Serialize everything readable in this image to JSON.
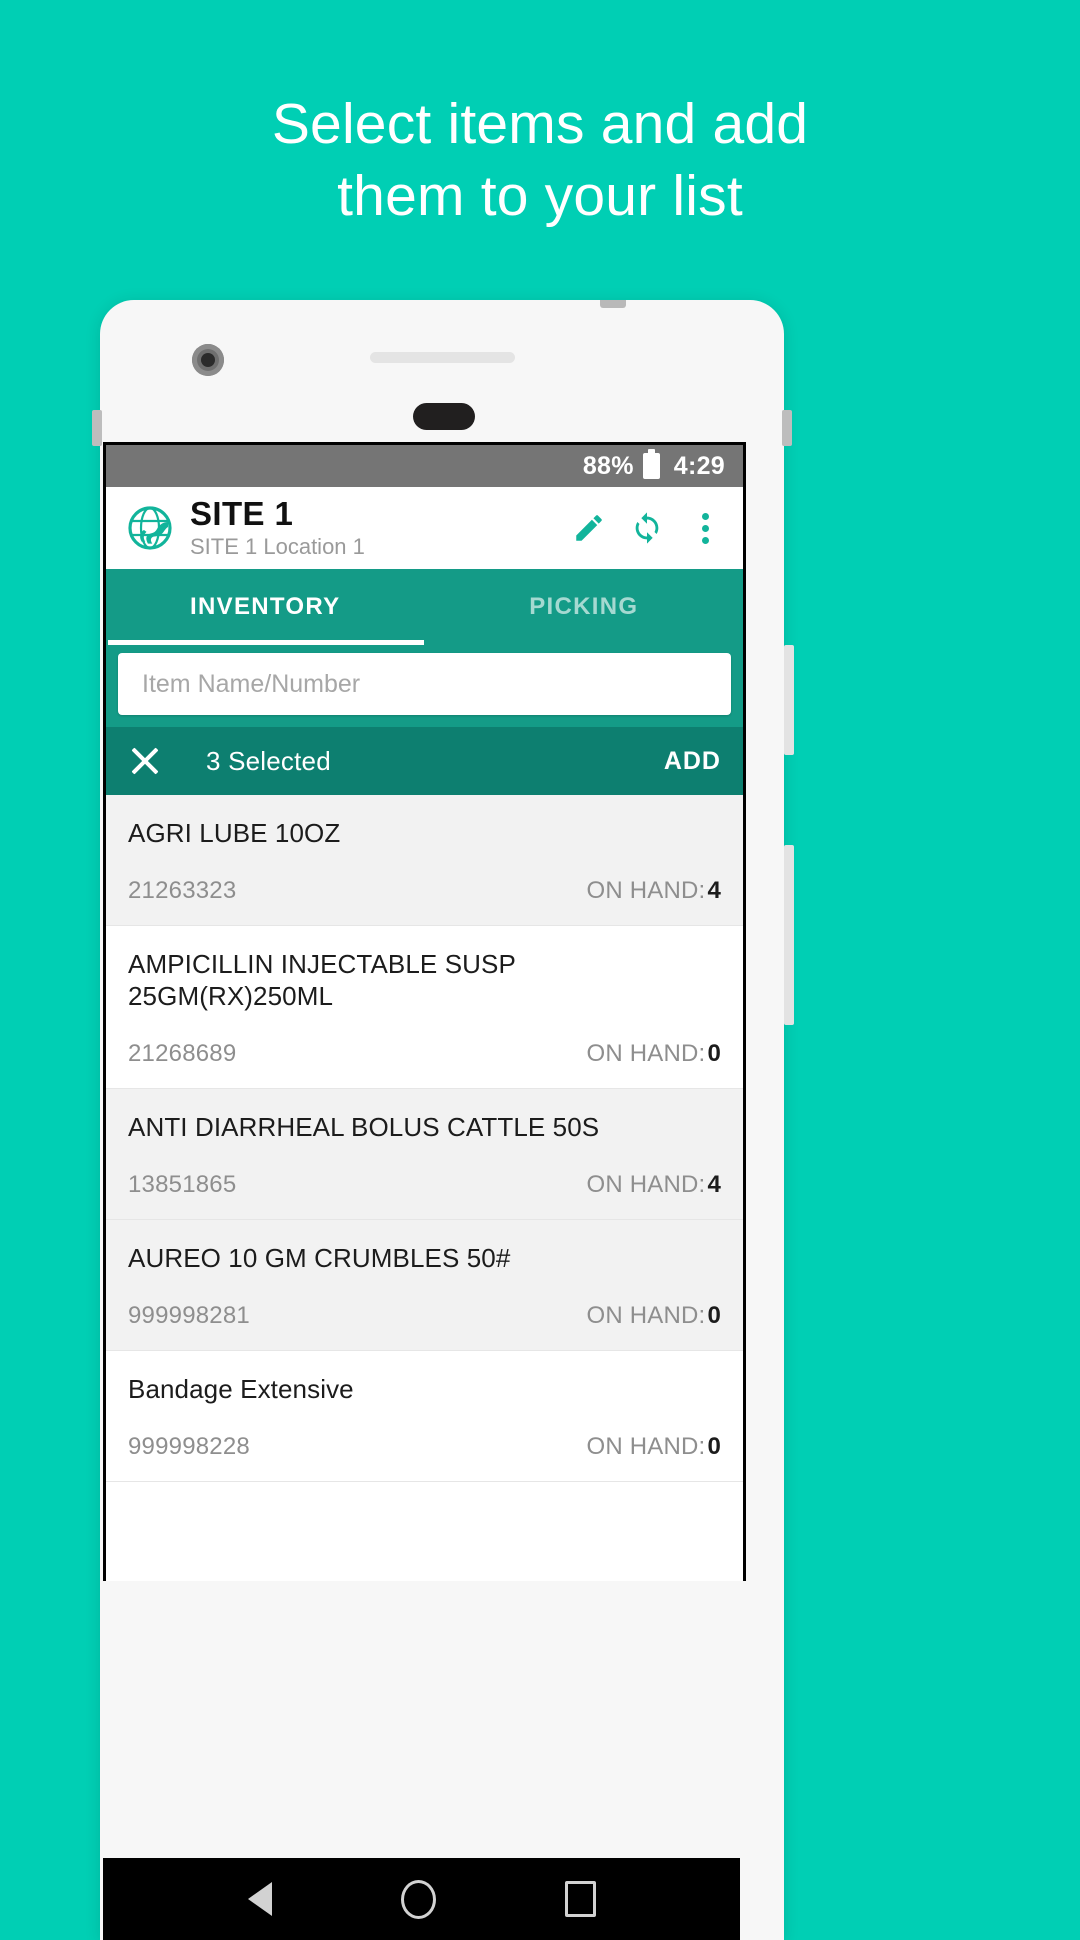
{
  "promo": {
    "headline_lines": [
      "Select items and add",
      "them to your list"
    ],
    "background_color": "#00cfb4"
  },
  "device": {
    "statusbar": {
      "battery_percent": "88%",
      "battery_icon": "battery-icon",
      "time": "4:29"
    },
    "navbar": {
      "back": "back-triangle-icon",
      "home": "home-circle-icon",
      "recents": "recents-square-icon"
    }
  },
  "appbar": {
    "logo": "globe-horse-logo-icon",
    "title": "SITE 1",
    "subtitle": "SITE 1 Location 1",
    "actions": [
      {
        "name": "edit-icon",
        "label": "Edit"
      },
      {
        "name": "sync-icon",
        "label": "Sync"
      },
      {
        "name": "overflow-menu-icon",
        "label": "More options"
      }
    ]
  },
  "tabs": [
    {
      "label": "INVENTORY",
      "active": true
    },
    {
      "label": "PICKING",
      "active": false
    }
  ],
  "search": {
    "placeholder": "Item Name/Number",
    "value": ""
  },
  "selection_bar": {
    "close_icon": "close-icon",
    "count_label": "3 Selected",
    "add_label": "ADD",
    "background_color": "#0d7f70"
  },
  "list": {
    "on_hand_label": "ON HAND:",
    "items": [
      {
        "name": "AGRI LUBE 10OZ",
        "number": "21263323",
        "on_hand": "4",
        "selected": true
      },
      {
        "name": "AMPICILLIN INJECTABLE SUSP 25GM(RX)250ML",
        "number": "21268689",
        "on_hand": "0",
        "selected": false
      },
      {
        "name": "ANTI DIARRHEAL BOLUS CATTLE 50S",
        "number": "13851865",
        "on_hand": "4",
        "selected": true
      },
      {
        "name": "AUREO 10 GM CRUMBLES 50#",
        "number": "999998281",
        "on_hand": "0",
        "selected": true
      },
      {
        "name": "Bandage Extensive",
        "number": "999998228",
        "on_hand": "0",
        "selected": false
      }
    ]
  },
  "theme": {
    "accent": "#12b49b",
    "tabbar": "#149b87",
    "promo_bg": "#00cfb4"
  }
}
